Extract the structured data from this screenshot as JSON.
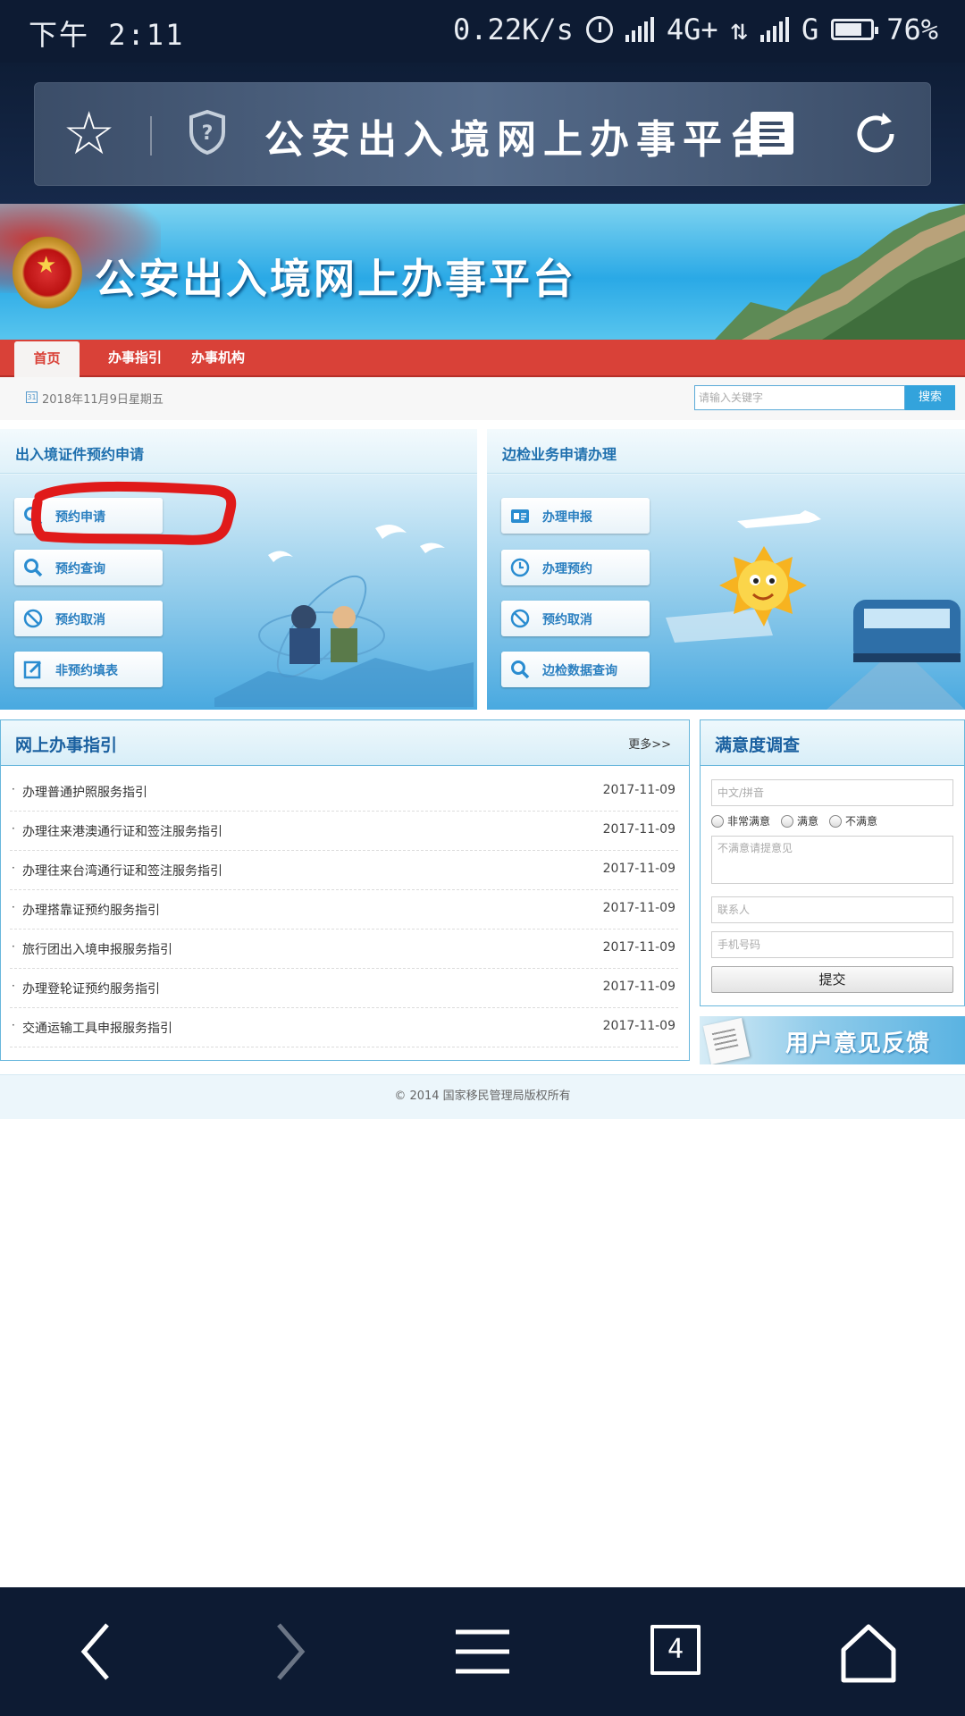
{
  "status_bar": {
    "time": "下午 2:11",
    "net_speed": "0.22K/s",
    "network1": "4G+",
    "network2": "G",
    "battery": "76%",
    "battery_level": 0.76
  },
  "browser": {
    "title": "公安出入境网上办事平台",
    "tabs_count": "4"
  },
  "banner": {
    "title": "公安出入境网上办事平台"
  },
  "nav": {
    "items": [
      "首页",
      "办事指引",
      "办事机构"
    ],
    "active": "首页"
  },
  "toolbar": {
    "date": "2018年11月9日星期五",
    "search_placeholder": "请输入关键字",
    "search_button": "搜索"
  },
  "panels": {
    "left": {
      "title": "出入境证件预约申请",
      "buttons": [
        "预约申请",
        "预约查询",
        "预约取消",
        "非预约填表"
      ]
    },
    "right": {
      "title": "边检业务申请办理",
      "buttons": [
        "办理申报",
        "办理预约",
        "预约取消",
        "边检数据查询"
      ]
    }
  },
  "guide": {
    "title": "网上办事指引",
    "more": "更多>>",
    "items": [
      {
        "title": "办理普通护照服务指引",
        "date": "2017-11-09"
      },
      {
        "title": "办理往来港澳通行证和签注服务指引",
        "date": "2017-11-09"
      },
      {
        "title": "办理往来台湾通行证和签注服务指引",
        "date": "2017-11-09"
      },
      {
        "title": "办理搭靠证预约服务指引",
        "date": "2017-11-09"
      },
      {
        "title": "旅行团出入境申报服务指引",
        "date": "2017-11-09"
      },
      {
        "title": "办理登轮证预约服务指引",
        "date": "2017-11-09"
      },
      {
        "title": "交通运输工具申报服务指引",
        "date": "2017-11-09"
      }
    ]
  },
  "survey": {
    "title": "满意度调查",
    "name_placeholder": "中文/拼音",
    "options": [
      "非常满意",
      "满意",
      "不满意"
    ],
    "comment_placeholder": "不满意请提意见",
    "contact_placeholder": "联系人",
    "phone_placeholder": "手机号码",
    "submit": "提交"
  },
  "feedback": {
    "label": "用户意见反馈"
  },
  "footer": {
    "copyright": "© 2014 国家移民管理局版权所有"
  },
  "colors": {
    "nav_red": "#d94138",
    "link_blue": "#1a60a0",
    "accent_blue": "#33a3dc",
    "dark_chrome": "#0d1b33"
  }
}
